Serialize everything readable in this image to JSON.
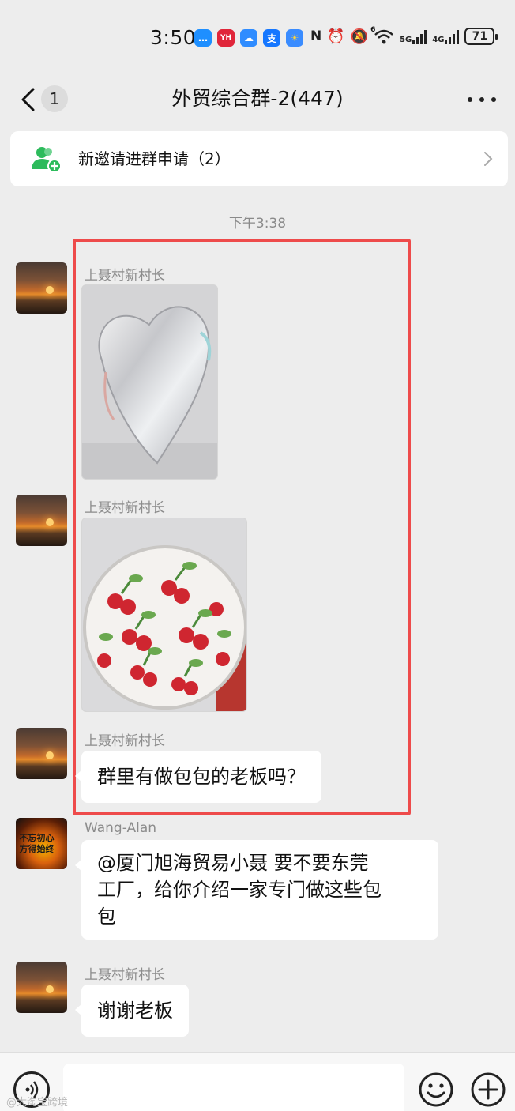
{
  "status_bar": {
    "time": "3:50",
    "battery": "71",
    "net_5g": "5G",
    "net_4g": "4G",
    "wifi_num": "6",
    "nfc_glyph": "N",
    "apps": [
      {
        "icon": "message-app-icon",
        "color": "#1e8fff",
        "glyph": "…"
      },
      {
        "icon": "yh-app-icon",
        "color": "#e0263a",
        "glyph": "YH"
      },
      {
        "icon": "cloud-app-icon",
        "color": "#2f8cff",
        "glyph": "☁"
      },
      {
        "icon": "alipay-app-icon",
        "color": "#1677ff",
        "glyph": "支"
      },
      {
        "icon": "weather-app-icon",
        "color": "#3a8cff",
        "glyph": "☀"
      }
    ]
  },
  "header": {
    "title": "外贸综合群-2(447)",
    "unread_count": "1"
  },
  "invite_banner": {
    "label": "新邀请进群申请（2）"
  },
  "chat": {
    "timestamp": "下午3:38",
    "messages": [
      {
        "sender": "上聂村新村长",
        "type": "image",
        "image": "holographic-heart-bag-photo"
      },
      {
        "sender": "上聂村新村长",
        "type": "image",
        "image": "cherry-round-bag-photo"
      },
      {
        "sender": "上聂村新村长",
        "type": "text",
        "text": "群里有做包包的老板吗？"
      },
      {
        "sender": "Wang-Alan",
        "type": "text",
        "text_lines": [
          "@厦门旭海贸易小聂  要不要东莞",
          "工厂，给你介绍一家专门做这些包",
          "包"
        ]
      },
      {
        "sender": "上聂村新村长",
        "type": "text",
        "text": "谢谢老板"
      }
    ],
    "wang_avatar_text": "不忘初心 方得始终"
  },
  "watermark": "@大淘宝跨境",
  "colors": {
    "highlight_border": "#ee4b4b",
    "invite_icon": "#2dbb5c",
    "background": "#ededed"
  }
}
